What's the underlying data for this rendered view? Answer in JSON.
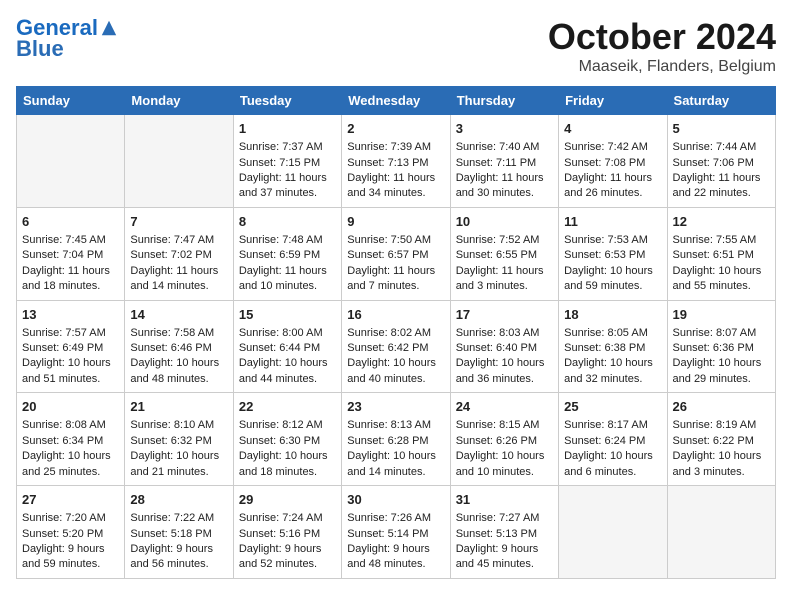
{
  "header": {
    "logo_line1": "General",
    "logo_line2": "Blue",
    "month_year": "October 2024",
    "location": "Maaseik, Flanders, Belgium"
  },
  "weekdays": [
    "Sunday",
    "Monday",
    "Tuesday",
    "Wednesday",
    "Thursday",
    "Friday",
    "Saturday"
  ],
  "weeks": [
    [
      {
        "day": "",
        "empty": true
      },
      {
        "day": "",
        "empty": true
      },
      {
        "day": "1",
        "sunrise": "7:37 AM",
        "sunset": "7:15 PM",
        "daylight": "11 hours and 37 minutes."
      },
      {
        "day": "2",
        "sunrise": "7:39 AM",
        "sunset": "7:13 PM",
        "daylight": "11 hours and 34 minutes."
      },
      {
        "day": "3",
        "sunrise": "7:40 AM",
        "sunset": "7:11 PM",
        "daylight": "11 hours and 30 minutes."
      },
      {
        "day": "4",
        "sunrise": "7:42 AM",
        "sunset": "7:08 PM",
        "daylight": "11 hours and 26 minutes."
      },
      {
        "day": "5",
        "sunrise": "7:44 AM",
        "sunset": "7:06 PM",
        "daylight": "11 hours and 22 minutes."
      }
    ],
    [
      {
        "day": "6",
        "sunrise": "7:45 AM",
        "sunset": "7:04 PM",
        "daylight": "11 hours and 18 minutes."
      },
      {
        "day": "7",
        "sunrise": "7:47 AM",
        "sunset": "7:02 PM",
        "daylight": "11 hours and 14 minutes."
      },
      {
        "day": "8",
        "sunrise": "7:48 AM",
        "sunset": "6:59 PM",
        "daylight": "11 hours and 10 minutes."
      },
      {
        "day": "9",
        "sunrise": "7:50 AM",
        "sunset": "6:57 PM",
        "daylight": "11 hours and 7 minutes."
      },
      {
        "day": "10",
        "sunrise": "7:52 AM",
        "sunset": "6:55 PM",
        "daylight": "11 hours and 3 minutes."
      },
      {
        "day": "11",
        "sunrise": "7:53 AM",
        "sunset": "6:53 PM",
        "daylight": "10 hours and 59 minutes."
      },
      {
        "day": "12",
        "sunrise": "7:55 AM",
        "sunset": "6:51 PM",
        "daylight": "10 hours and 55 minutes."
      }
    ],
    [
      {
        "day": "13",
        "sunrise": "7:57 AM",
        "sunset": "6:49 PM",
        "daylight": "10 hours and 51 minutes."
      },
      {
        "day": "14",
        "sunrise": "7:58 AM",
        "sunset": "6:46 PM",
        "daylight": "10 hours and 48 minutes."
      },
      {
        "day": "15",
        "sunrise": "8:00 AM",
        "sunset": "6:44 PM",
        "daylight": "10 hours and 44 minutes."
      },
      {
        "day": "16",
        "sunrise": "8:02 AM",
        "sunset": "6:42 PM",
        "daylight": "10 hours and 40 minutes."
      },
      {
        "day": "17",
        "sunrise": "8:03 AM",
        "sunset": "6:40 PM",
        "daylight": "10 hours and 36 minutes."
      },
      {
        "day": "18",
        "sunrise": "8:05 AM",
        "sunset": "6:38 PM",
        "daylight": "10 hours and 32 minutes."
      },
      {
        "day": "19",
        "sunrise": "8:07 AM",
        "sunset": "6:36 PM",
        "daylight": "10 hours and 29 minutes."
      }
    ],
    [
      {
        "day": "20",
        "sunrise": "8:08 AM",
        "sunset": "6:34 PM",
        "daylight": "10 hours and 25 minutes."
      },
      {
        "day": "21",
        "sunrise": "8:10 AM",
        "sunset": "6:32 PM",
        "daylight": "10 hours and 21 minutes."
      },
      {
        "day": "22",
        "sunrise": "8:12 AM",
        "sunset": "6:30 PM",
        "daylight": "10 hours and 18 minutes."
      },
      {
        "day": "23",
        "sunrise": "8:13 AM",
        "sunset": "6:28 PM",
        "daylight": "10 hours and 14 minutes."
      },
      {
        "day": "24",
        "sunrise": "8:15 AM",
        "sunset": "6:26 PM",
        "daylight": "10 hours and 10 minutes."
      },
      {
        "day": "25",
        "sunrise": "8:17 AM",
        "sunset": "6:24 PM",
        "daylight": "10 hours and 6 minutes."
      },
      {
        "day": "26",
        "sunrise": "8:19 AM",
        "sunset": "6:22 PM",
        "daylight": "10 hours and 3 minutes."
      }
    ],
    [
      {
        "day": "27",
        "sunrise": "7:20 AM",
        "sunset": "5:20 PM",
        "daylight": "9 hours and 59 minutes."
      },
      {
        "day": "28",
        "sunrise": "7:22 AM",
        "sunset": "5:18 PM",
        "daylight": "9 hours and 56 minutes."
      },
      {
        "day": "29",
        "sunrise": "7:24 AM",
        "sunset": "5:16 PM",
        "daylight": "9 hours and 52 minutes."
      },
      {
        "day": "30",
        "sunrise": "7:26 AM",
        "sunset": "5:14 PM",
        "daylight": "9 hours and 48 minutes."
      },
      {
        "day": "31",
        "sunrise": "7:27 AM",
        "sunset": "5:13 PM",
        "daylight": "9 hours and 45 minutes."
      },
      {
        "day": "",
        "empty": true
      },
      {
        "day": "",
        "empty": true
      }
    ]
  ]
}
